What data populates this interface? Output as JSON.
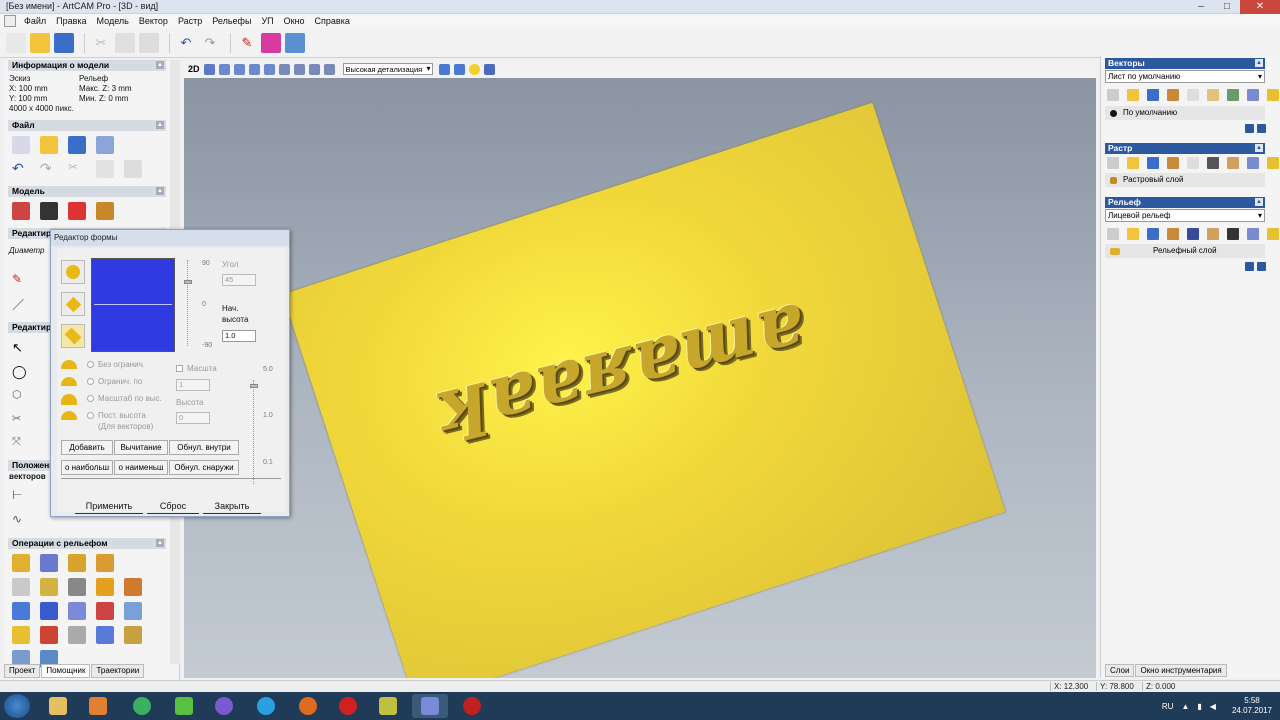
{
  "window": {
    "title": "[Без имени] - ArtCAM Pro - [3D - вид]"
  },
  "menu": [
    "Файл",
    "Правка",
    "Модель",
    "Вектор",
    "Растр",
    "Рельефы",
    "УП",
    "Окно",
    "Справка"
  ],
  "view_toolbar": {
    "mode_label": "2D",
    "detail_select": "Высокая детализация"
  },
  "left_panel": {
    "model_info": {
      "header": "Информация о модели",
      "col1_title": "Эскиз",
      "col1_x": "X: 100 mm",
      "col1_y": "Y: 100 mm",
      "size": "4000 x 4000 пикс.",
      "col2_title": "Рельеф",
      "col2_max": "Макс. Z: 3 mm",
      "col2_min": "Мин. Z: 0 mm"
    },
    "file_header": "Файл",
    "model_header": "Модель",
    "editing_header": "Редактиро",
    "diameter_label": "Диаметр",
    "vector_editing_header": "Редактиро",
    "position_header": "Положени",
    "position_sub": "векторов",
    "relief_ops_header": "Операции с рельефом",
    "tabs": [
      "Проект",
      "Помощник",
      "Траектории"
    ]
  },
  "shape_editor": {
    "title": "Редактор формы",
    "angle_label": "Угол",
    "angle_value": "45",
    "scale_top": "90",
    "scale_mid": "0",
    "scale_bottom": "-90",
    "start_height_label1": "Нач.",
    "start_height_label2": "высота",
    "start_height_value": "1.0",
    "opt_unlimited": "Без огранич.",
    "opt_limited": "Огранич. по",
    "opt_scale_height": "Масштаб по выс.",
    "opt_const_height": "Пост. высота",
    "opt_const_height_sub": "(Для векторов)",
    "scale_check_label": "Масшта",
    "scale_value": "1",
    "height_label": "Высота",
    "height_value": "0",
    "right_scale_top": "5.0",
    "right_scale_mid": "1.0",
    "right_scale_bottom": "0.1",
    "btn_add": "Добавить",
    "btn_subtract": "Вычитание",
    "btn_zero_inside": "Обнул. внутри",
    "btn_max": "о наибольш",
    "btn_min": "о наименьш",
    "btn_zero_outside": "Обнул. снаружи",
    "btn_apply": "Применить",
    "btn_reset": "Сброс",
    "btn_close": "Закрыть"
  },
  "viewport": {
    "relief_text": "ʞɐɐʁɐɯɐ"
  },
  "right_panel": {
    "vectors_header": "Векторы",
    "vectors_select": "Лист по умолчанию",
    "vector_layer": "По умолчанию",
    "raster_header": "Растр",
    "raster_layer": "Растровый слой",
    "relief_header": "Рельеф",
    "relief_select": "Лицевой рельеф",
    "relief_layer": "Рельефный слой",
    "tabs": [
      "Слои",
      "Окно инструментария"
    ]
  },
  "status": {
    "x": "X: 12.300",
    "y": "Y: 78.800",
    "z": "Z: 0.000"
  },
  "taskbar": {
    "lang": "RU",
    "time": "5:58",
    "date": "24.07.2017"
  },
  "colors": {
    "accent": "#2c58a0",
    "preview_blue": "#2f3ae0",
    "relief_yellow": "#f1d83a"
  }
}
